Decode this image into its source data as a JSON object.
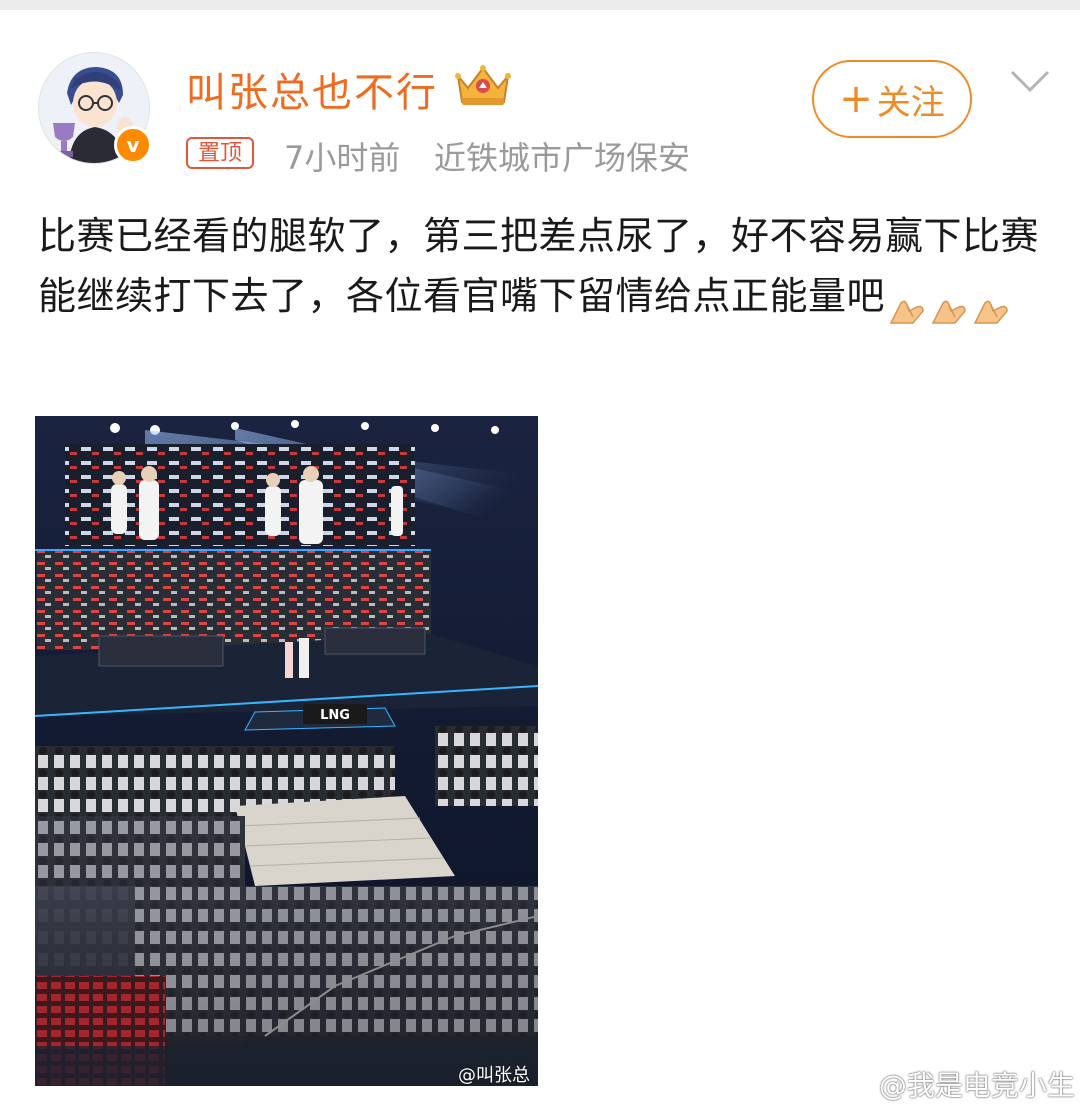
{
  "post": {
    "username": "叫张总也不行",
    "pinned_label": "置顶",
    "time": "7小时前",
    "source": "近铁城市广场保安",
    "follow_label": "关注",
    "follow_plus": "+",
    "verified_badge": "v",
    "text_main": "比赛已经看的腿软了，第三把差点尿了，好不容易赢下比赛能继续打下去了，各位看官嘴下留情给点正能量吧",
    "emoji": [
      "pray-hands",
      "pray-hands",
      "pray-hands"
    ]
  },
  "photo": {
    "watermark": "@叫张总",
    "stage_logo": "LNG"
  },
  "page_watermark": "@我是电竞小生",
  "colors": {
    "username": "#f06a1f",
    "follow": "#f08a24",
    "pinned": "#e0573a",
    "meta": "#9a9a9a",
    "verified": "#ff8a00"
  },
  "icons": [
    "crown-badge-icon",
    "chevron-down-icon",
    "verified-icon",
    "weibo-icon"
  ]
}
